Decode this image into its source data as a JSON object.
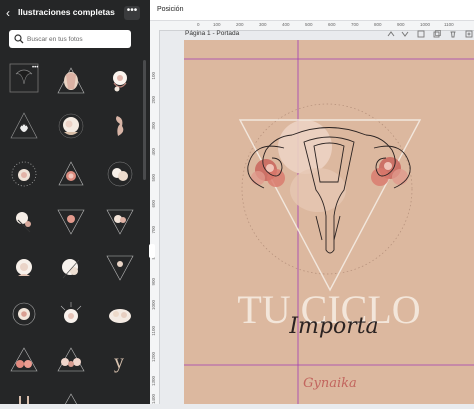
{
  "panel": {
    "back_icon": "chevron-left-icon",
    "title": "Ilustraciones completas",
    "more_label": "•••",
    "search": {
      "placeholder": "Buscar en tus fotos"
    }
  },
  "toolbar": {
    "position_label": "Posición"
  },
  "ruler": {
    "top_ticks": [
      "0",
      "100",
      "200",
      "300",
      "400",
      "500",
      "600",
      "700",
      "800",
      "900",
      "1000",
      "1100"
    ],
    "left_ticks": [
      "100",
      "200",
      "300",
      "400",
      "500",
      "600",
      "700",
      "800",
      "900",
      "1000",
      "1100",
      "1200",
      "1300",
      "1400"
    ]
  },
  "page": {
    "label": "Página 1 - Portada",
    "actions": [
      "chevron-up-icon",
      "chevron-down-icon",
      "duplicate-icon",
      "copy-icon",
      "delete-icon",
      "add-page-icon"
    ]
  },
  "design": {
    "title_main": "TU CICLO",
    "title_script": "Importa",
    "brand": "Gynaika",
    "colors": {
      "background": "#dcb89f",
      "accent": "#c2655e",
      "line": "#2b2322",
      "title": "#f3e6da",
      "guide": "#a23bb4"
    }
  }
}
